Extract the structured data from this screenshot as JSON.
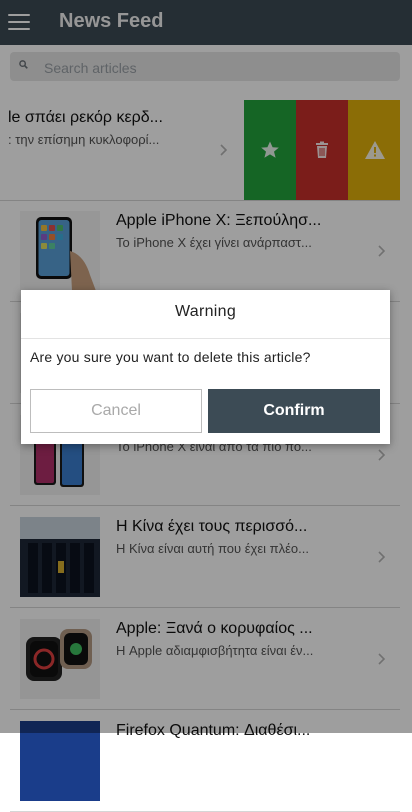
{
  "header": {
    "title": "News Feed",
    "menu_icon": "hamburger-icon"
  },
  "search": {
    "placeholder": "Search articles",
    "value": ""
  },
  "articles": [
    {
      "title": "le σπάει ρεκόρ κερδ...",
      "summary": ": την επίσημη κυκλοφορί..."
    },
    {
      "title": "Apple iPhone X: Ξεπούλησ...",
      "summary": "Το iPhone X έχει γίνει ανάρπαστ..."
    },
    {
      "title": "",
      "summary": ""
    },
    {
      "title": "",
      "summary": "Το iPhone X είναι από τα πιο πο..."
    },
    {
      "title": "Η Κίνα έχει τους περισσό...",
      "summary": "Η Κίνα είναι αυτή που έχει πλέο..."
    },
    {
      "title": "Apple: Ξανά ο κορυφαίος ...",
      "summary": "Η Apple αδιαμφισβήτητα είναι έν..."
    },
    {
      "title": "Firefox Quantum: Διαθέσι...",
      "summary": ""
    }
  ],
  "swipe_actions": [
    {
      "icon": "star-icon",
      "color": "#22a33c"
    },
    {
      "icon": "trash-icon",
      "color": "#c7302a"
    },
    {
      "icon": "warning-icon",
      "color": "#e1b10a"
    }
  ],
  "dialog": {
    "title": "Warning",
    "message": "Are you sure you want to delete this article?",
    "cancel_label": "Cancel",
    "confirm_label": "Confirm"
  },
  "colors": {
    "header": "#3c4b55",
    "confirm": "#3c4b55"
  }
}
